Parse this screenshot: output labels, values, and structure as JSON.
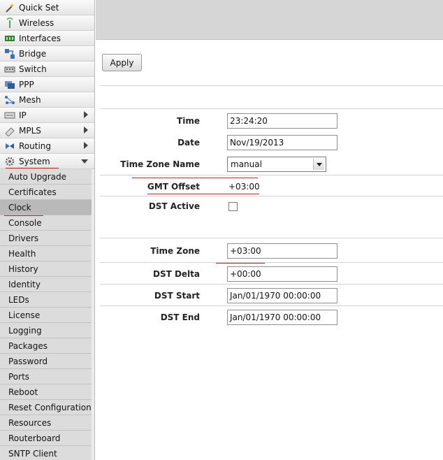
{
  "sidebar": {
    "items": [
      {
        "label": "Quick Set",
        "icon": "wand-icon",
        "arrow": ""
      },
      {
        "label": "Wireless",
        "icon": "antenna-icon",
        "arrow": ""
      },
      {
        "label": "Interfaces",
        "icon": "interfaces-icon",
        "arrow": ""
      },
      {
        "label": "Bridge",
        "icon": "bridge-icon",
        "arrow": ""
      },
      {
        "label": "Switch",
        "icon": "switch-icon",
        "arrow": ""
      },
      {
        "label": "PPP",
        "icon": "ppp-icon",
        "arrow": ""
      },
      {
        "label": "Mesh",
        "icon": "mesh-icon",
        "arrow": ""
      },
      {
        "label": "IP",
        "icon": "ip-icon",
        "arrow": "right"
      },
      {
        "label": "MPLS",
        "icon": "mpls-icon",
        "arrow": "right"
      },
      {
        "label": "Routing",
        "icon": "routing-icon",
        "arrow": "right"
      },
      {
        "label": "System",
        "icon": "gear-icon",
        "arrow": "down"
      }
    ],
    "submenu": [
      "Auto Upgrade",
      "Certificates",
      "Clock",
      "Console",
      "Drivers",
      "Health",
      "History",
      "Identity",
      "LEDs",
      "License",
      "Logging",
      "Packages",
      "Password",
      "Ports",
      "Reboot",
      "Reset Configuration",
      "Resources",
      "Routerboard",
      "SNTP Client"
    ],
    "selected_submenu": "Clock"
  },
  "toolbar": {
    "apply_label": "Apply"
  },
  "form": {
    "time": {
      "label": "Time",
      "value": "23:24:20"
    },
    "date": {
      "label": "Date",
      "value": "Nov/19/2013"
    },
    "timezone_name": {
      "label": "Time Zone Name",
      "value": "manual"
    },
    "gmt_offset": {
      "label": "GMT Offset",
      "value": "+03:00"
    },
    "dst_active": {
      "label": "DST Active",
      "checked": false
    },
    "time_zone": {
      "label": "Time Zone",
      "value": "+03:00"
    },
    "dst_delta": {
      "label": "DST Delta",
      "value": "+00:00"
    },
    "dst_start": {
      "label": "DST Start",
      "value": "Jan/01/1970 00:00:00"
    },
    "dst_end": {
      "label": "DST End",
      "value": "Jan/01/1970 00:00:00"
    }
  },
  "colors": {
    "annotation_underline": "#c32020"
  }
}
